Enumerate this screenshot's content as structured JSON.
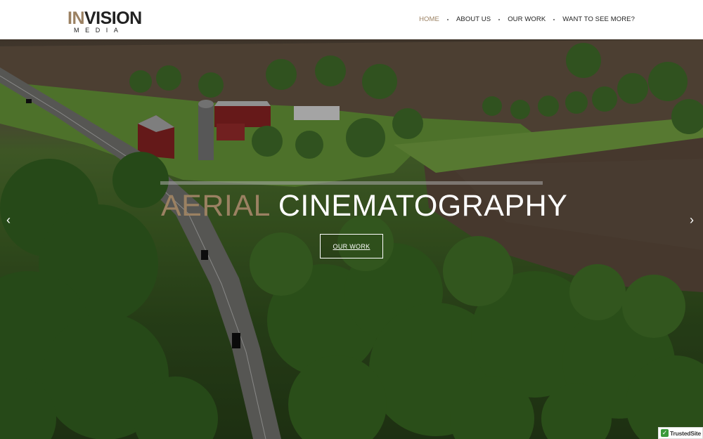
{
  "header": {
    "logo": {
      "main_a": "IN",
      "main_b": "VISION",
      "sub": "MEDIA"
    },
    "nav": [
      {
        "label": "HOME",
        "active": true
      },
      {
        "label": "ABOUT US",
        "active": false
      },
      {
        "label": "OUR WORK",
        "active": false
      },
      {
        "label": "WANT TO SEE MORE?",
        "active": false
      }
    ]
  },
  "hero": {
    "headline_word1": "AERIAL",
    "headline_word2": "CINEMATOGRAPHY",
    "cta_label": "OUR WORK",
    "prev_arrow": "‹",
    "next_arrow": "›"
  },
  "badge": {
    "label": "TrustedSite",
    "check": "✓"
  },
  "colors": {
    "accent": "#9b8162",
    "text": "#222222",
    "white": "#ffffff"
  },
  "icons": {
    "prev": "chevron-left-icon",
    "next": "chevron-right-icon",
    "badge": "check-icon"
  }
}
